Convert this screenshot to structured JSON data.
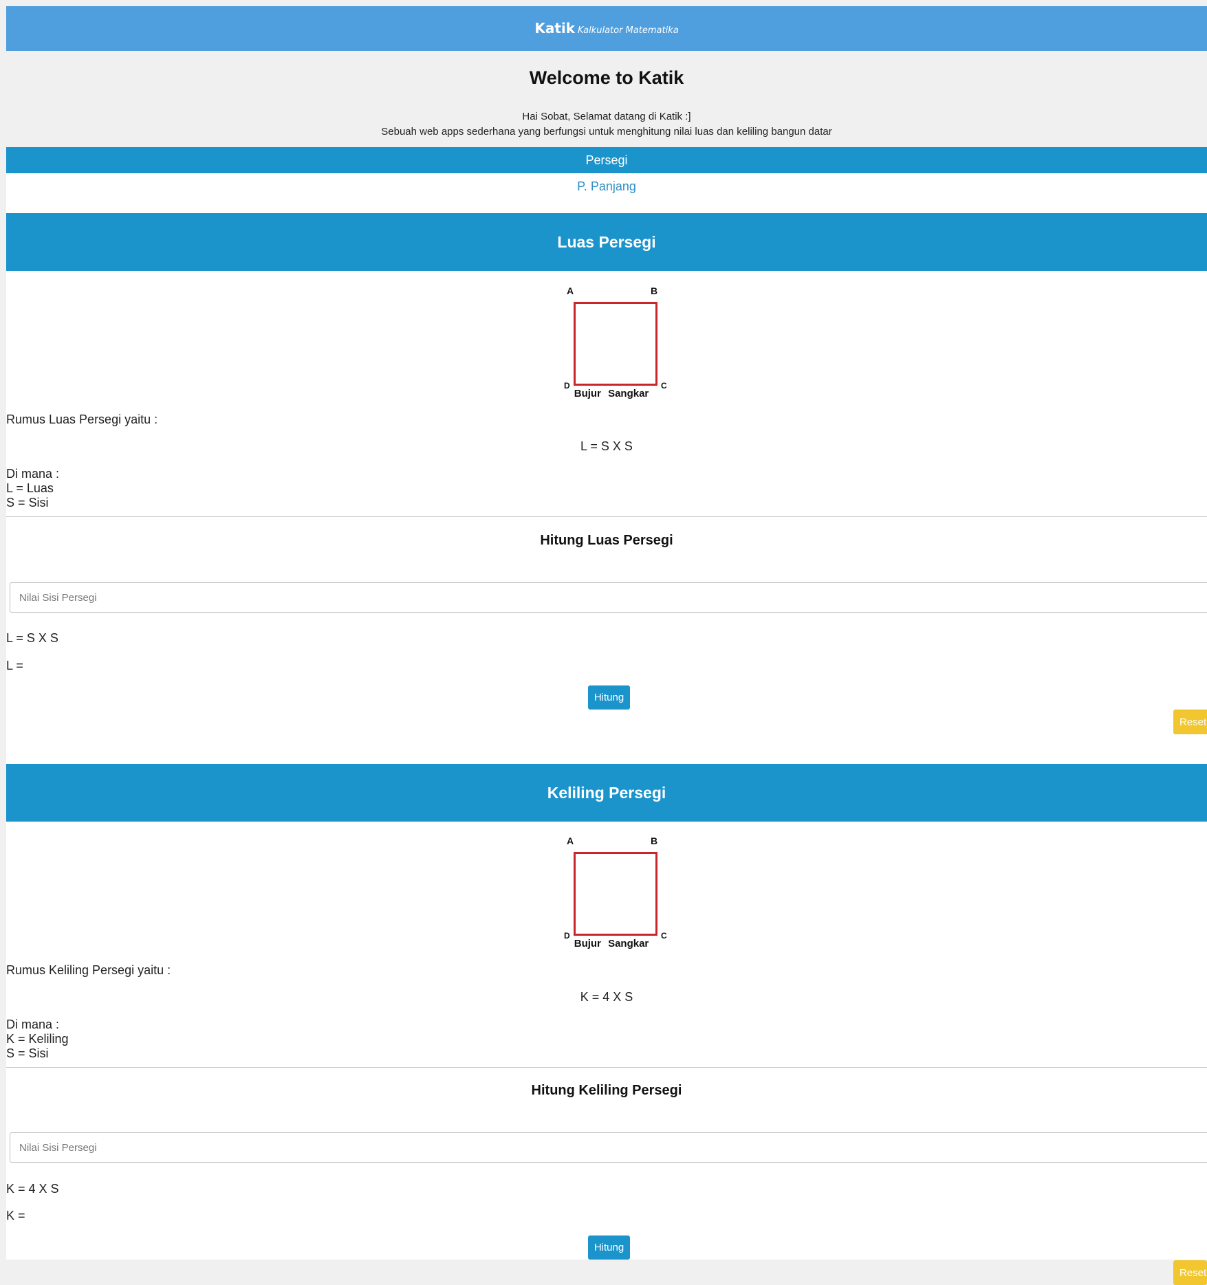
{
  "header": {
    "brand": "Katik",
    "tagline": "Kalkulator Matematika"
  },
  "intro": {
    "title": "Welcome to Katik",
    "greeting": "Hai Sobat, Selamat datang di Katik :]",
    "description": "Sebuah web apps sederhana yang berfungsi untuk menghitung nilai luas dan keliling bangun datar"
  },
  "nav": {
    "active": "Persegi",
    "link": "P. Panjang"
  },
  "luas": {
    "banner": "Luas Persegi",
    "diagram": {
      "a": "A",
      "b": "B",
      "c": "C",
      "d": "D",
      "caption": "Bujur Sangkar"
    },
    "rumus_intro": "Rumus Luas Persegi yaitu :",
    "formula": "L = S X S",
    "dimana": "Di mana :",
    "def1": "L = Luas",
    "def2": "S = Sisi",
    "calc_title": "Hitung Luas Persegi",
    "input_placeholder": "Nilai Sisi Persegi",
    "result_formula": "L = S X S",
    "result": "L =",
    "hitung": "Hitung",
    "reset": "Reset"
  },
  "keliling": {
    "banner": "Keliling Persegi",
    "diagram": {
      "a": "A",
      "b": "B",
      "c": "C",
      "d": "D",
      "caption": "Bujur Sangkar"
    },
    "rumus_intro": "Rumus Keliling Persegi yaitu :",
    "formula": "K = 4 X S",
    "dimana": "Di mana :",
    "def1": "K = Keliling",
    "def2": "S = Sisi",
    "calc_title": "Hitung Keliling Persegi",
    "input_placeholder": "Nilai Sisi Persegi",
    "result_formula": "K = 4 X S",
    "result": "K =",
    "hitung": "Hitung",
    "reset": "Reset"
  },
  "colors": {
    "header_bg": "#4f9ede",
    "primary": "#1b94cc",
    "link": "#2e8fc6",
    "square_stroke": "#c8262b",
    "reset_bg": "#f1c62f",
    "page_bg": "#f0f0f1"
  }
}
